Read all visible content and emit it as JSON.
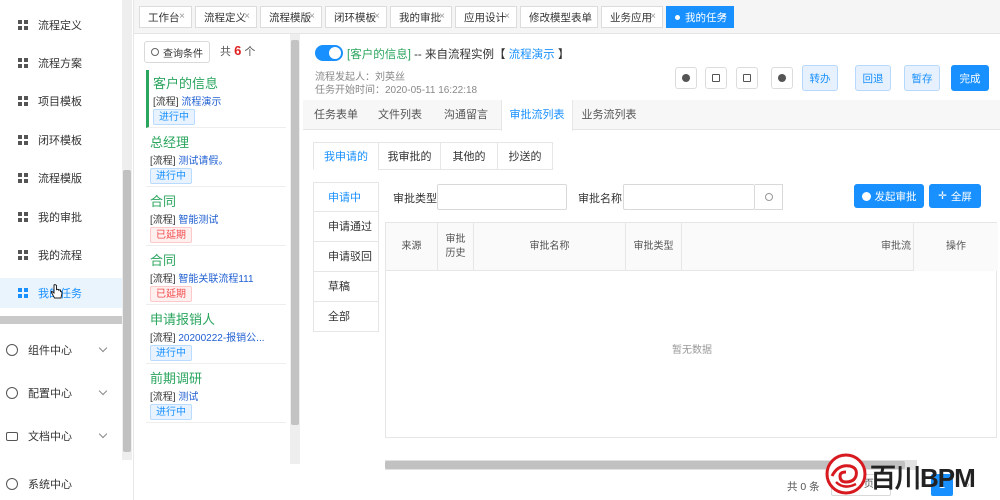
{
  "sidebar": {
    "items": [
      {
        "label": "流程定义",
        "active": false
      },
      {
        "label": "流程方案",
        "active": false
      },
      {
        "label": "项目模板",
        "active": false
      },
      {
        "label": "闭环模板",
        "active": false
      },
      {
        "label": "流程模版",
        "active": false
      },
      {
        "label": "我的审批",
        "active": false
      },
      {
        "label": "我的流程",
        "active": false
      },
      {
        "label": "我的任务",
        "active": true
      }
    ],
    "groups": [
      {
        "label": "组件中心",
        "icon": "gear-icon"
      },
      {
        "label": "配置中心",
        "icon": "gear-icon"
      },
      {
        "label": "文档中心",
        "icon": "folder-icon"
      },
      {
        "label": "系统中心",
        "icon": "gear-icon"
      }
    ]
  },
  "tabs": [
    {
      "label": "工作台",
      "active": false
    },
    {
      "label": "流程定义",
      "active": false
    },
    {
      "label": "流程模版",
      "active": false
    },
    {
      "label": "闭环模板",
      "active": false
    },
    {
      "label": "我的审批",
      "active": false
    },
    {
      "label": "应用设计",
      "active": false
    },
    {
      "label": "修改模型表单",
      "active": false
    },
    {
      "label": "业务应用",
      "active": false
    },
    {
      "label": "我的任务",
      "active": true
    }
  ],
  "tasklist": {
    "query_label": "查询条件",
    "count_prefix": "共",
    "count": "6",
    "count_suffix": "个",
    "items": [
      {
        "title": "客户的信息",
        "prefix": "[流程]",
        "flow": "流程演示",
        "status": "进行中",
        "status_type": "run"
      },
      {
        "title": "总经理",
        "prefix": "[流程]",
        "flow": "测试请假。",
        "status": "进行中",
        "status_type": "run"
      },
      {
        "title": "合同",
        "prefix": "[流程]",
        "flow": "智能测试",
        "status": "已延期",
        "status_type": "late"
      },
      {
        "title": "合同",
        "prefix": "[流程]",
        "flow": "智能关联流程111",
        "status": "已延期",
        "status_type": "late"
      },
      {
        "title": "申请报销人",
        "prefix": "[流程]",
        "flow": "20200222-报销公...",
        "status": "进行中",
        "status_type": "run"
      },
      {
        "title": "前期调研",
        "prefix": "[流程]",
        "flow": "测试",
        "status": "进行中",
        "status_type": "run"
      }
    ]
  },
  "detail": {
    "title_customer": "[客户的信息]",
    "title_from": " -- 来自流程实例【 ",
    "title_flow": "流程演示",
    "title_end": " 】",
    "initiator": "流程发起人：刘英丝",
    "start_time": "任务开始时间：2020-05-11 16:22:18",
    "actions": {
      "transfer": "转办",
      "back": "回退",
      "save": "暂存",
      "complete": "完成"
    },
    "subtabs": [
      "任务表单",
      "文件列表",
      "沟通留言",
      "审批流列表",
      "业务流列表"
    ],
    "active_subtab": "审批流列表",
    "pills": [
      "我申请的",
      "我审批的",
      "其他的",
      "抄送的"
    ],
    "vtabs": [
      "申请中",
      "申请通过",
      "申请驳回",
      "草稿",
      "全部"
    ],
    "filter": {
      "type_label": "审批类型",
      "name_label": "审批名称",
      "start_btn": "发起审批",
      "fullscreen_btn": "全屏"
    },
    "table": {
      "columns": [
        "来源",
        "审批\n历史",
        "审批名称",
        "审批类型",
        "审批流",
        "操作"
      ],
      "empty": "暂无数据"
    },
    "pager": {
      "total": "共 0 条",
      "size": "10条/页",
      "page": "1"
    }
  },
  "logo": {
    "text": "百川BPM"
  },
  "colors": {
    "primary": "#1890ff",
    "green": "#2aa55e",
    "red": "#f24c4c"
  }
}
